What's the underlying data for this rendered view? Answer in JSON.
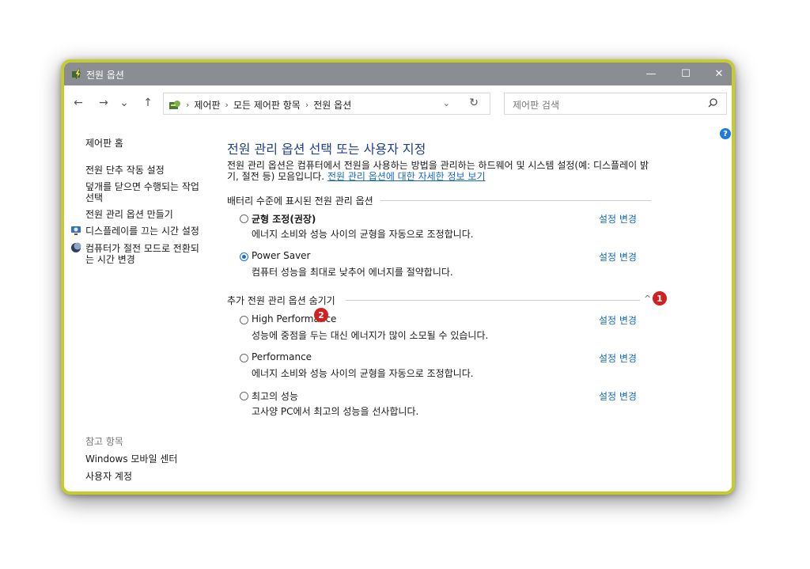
{
  "window": {
    "title": "전원 옵션",
    "minimize": "—",
    "maximize": "☐",
    "close": "✕",
    "border_color": "#c7cc2a",
    "titlebar_color": "#8a8e92"
  },
  "nav": {
    "back": "←",
    "forward": "→",
    "recent": "⌄",
    "up": "↑"
  },
  "address": {
    "crumbs": [
      "제어판",
      "모든 제어판 항목",
      "전원 옵션"
    ],
    "sep": "›",
    "dropdown": "⌄",
    "refresh": "↻"
  },
  "search": {
    "placeholder": "제어판 검색"
  },
  "help": "?",
  "sidebar": {
    "home": "제어판 홈",
    "items": [
      {
        "label": "전원 단추 작동 설정"
      },
      {
        "label": "덮개를 닫으면 수행되는 작업 선택"
      },
      {
        "label": "전원 관리 옵션 만들기"
      },
      {
        "label": "디스플레이를 끄는 시간 설정"
      },
      {
        "label": "컴퓨터가 절전 모드로 전환되는 시간 변경"
      }
    ],
    "see_also": "참고 항목",
    "see_also_items": [
      {
        "label": "Windows 모바일 센터"
      },
      {
        "label": "사용자 계정"
      }
    ]
  },
  "main": {
    "heading": "전원 관리 옵션 선택 또는 사용자 지정",
    "description": "전원 관리 옵션은 컴퓨터에서 전원을 사용하는 방법을 관리하는 하드웨어 및 시스템 설정(예: 디스플레이 밝기, 절전 등) 모음입니다.",
    "description_link": "전원 관리 옵션에 대한 자세한 정보 보기",
    "battery_section": "배터리 수준에 표시된 전원 관리 옵션",
    "extra_section": "추가 전원 관리 옵션 숨기기",
    "change_label": "설정 변경",
    "plans": [
      {
        "name": "균형 조정(권장)",
        "desc": "에너지 소비와 성능 사이의 균형을 자동으로 조정합니다.",
        "selected": false
      },
      {
        "name": "Power Saver",
        "desc": "컴퓨터 성능을 최대로 낮추어 에너지를 절약합니다.",
        "selected": true
      },
      {
        "name": "High Performance",
        "desc": "성능에 중점을 두는 대신 에너지가 많이 소모될 수 있습니다.",
        "selected": false
      },
      {
        "name": "Performance",
        "desc": "에너지 소비와 성능 사이의 균형을 자동으로 조정합니다.",
        "selected": false
      },
      {
        "name": "최고의 성능",
        "desc": "고사양 PC에서 최고의 성능을 선사합니다.",
        "selected": false
      }
    ],
    "badges": [
      "1",
      "2"
    ]
  }
}
